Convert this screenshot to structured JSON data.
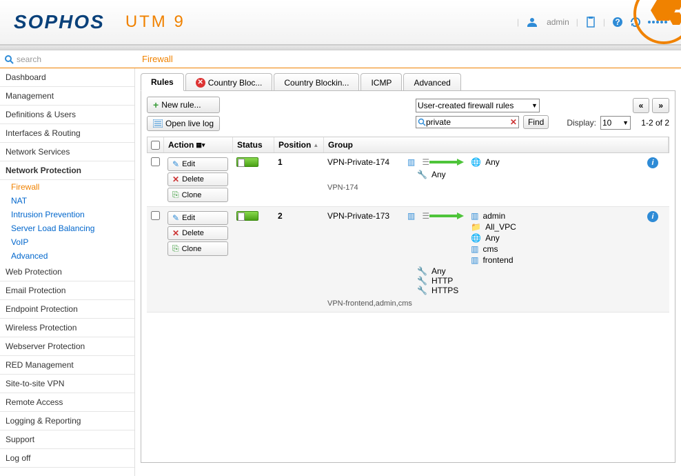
{
  "header": {
    "brand": "SOPHOS",
    "product": "UTM 9",
    "user": "admin"
  },
  "search": {
    "placeholder": "search"
  },
  "breadcrumb": "Firewall",
  "sidebar": {
    "items": [
      {
        "label": "Dashboard"
      },
      {
        "label": "Management"
      },
      {
        "label": "Definitions & Users"
      },
      {
        "label": "Interfaces & Routing"
      },
      {
        "label": "Network Services"
      },
      {
        "label": "Network Protection",
        "bold": true
      }
    ],
    "subs": [
      {
        "label": "Firewall",
        "active": true
      },
      {
        "label": "NAT"
      },
      {
        "label": "Intrusion Prevention"
      },
      {
        "label": "Server Load Balancing"
      },
      {
        "label": "VoIP"
      },
      {
        "label": "Advanced"
      }
    ],
    "items2": [
      {
        "label": "Web Protection"
      },
      {
        "label": "Email Protection"
      },
      {
        "label": "Endpoint Protection"
      },
      {
        "label": "Wireless Protection"
      },
      {
        "label": "Webserver Protection"
      },
      {
        "label": "RED Management"
      },
      {
        "label": "Site-to-site VPN"
      },
      {
        "label": "Remote Access"
      },
      {
        "label": "Logging & Reporting"
      },
      {
        "label": "Support"
      },
      {
        "label": "Log off"
      }
    ]
  },
  "tabs": [
    {
      "label": "Rules",
      "active": true
    },
    {
      "label": "Country Bloc...",
      "icon": "x"
    },
    {
      "label": "Country Blockin..."
    },
    {
      "label": "ICMP"
    },
    {
      "label": "Advanced"
    }
  ],
  "toolbar": {
    "new_rule": "New rule...",
    "open_log": "Open live log",
    "filter_select": "User-created firewall rules",
    "search_value": "private",
    "find": "Find",
    "display_label": "Display:",
    "display_value": "10",
    "count": "1-2 of 2",
    "prev": "«",
    "next": "»"
  },
  "columns": {
    "action": "Action",
    "status": "Status",
    "position": "Position",
    "group": "Group"
  },
  "action_btns": {
    "edit": "Edit",
    "delete": "Delete",
    "clone": "Clone"
  },
  "rules": [
    {
      "position": "1",
      "source": "VPN-Private-174",
      "services": [
        "Any"
      ],
      "dests": [
        {
          "icon": "globe",
          "label": "Any"
        }
      ],
      "desc": "VPN-174"
    },
    {
      "position": "2",
      "source": "VPN-Private-173",
      "services": [
        "Any",
        "HTTP",
        "HTTPS"
      ],
      "dests": [
        {
          "icon": "server",
          "label": "admin"
        },
        {
          "icon": "folder",
          "label": "All_VPC"
        },
        {
          "icon": "globe",
          "label": "Any"
        },
        {
          "icon": "server",
          "label": "cms"
        },
        {
          "icon": "server",
          "label": "frontend"
        }
      ],
      "desc": "VPN-frontend,admin,cms"
    }
  ]
}
